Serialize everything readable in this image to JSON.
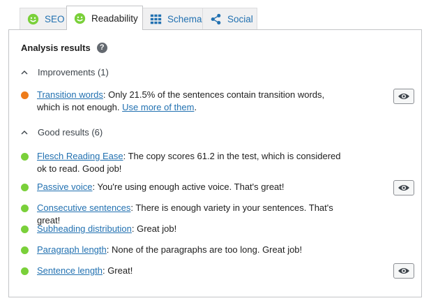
{
  "tabs": [
    {
      "label": "SEO",
      "icon": "smiley-icon"
    },
    {
      "label": "Readability",
      "icon": "smiley-icon"
    },
    {
      "label": "Schema",
      "icon": "grid-icon"
    },
    {
      "label": "Social",
      "icon": "share-icon"
    }
  ],
  "active_tab": "Readability",
  "colors": {
    "good": "#7ad03a",
    "improvement": "#ee7c1b",
    "link": "#2271b1"
  },
  "panel": {
    "title": "Analysis results",
    "help_label": "?",
    "improvements": {
      "heading": "Improvements (1)",
      "items": [
        {
          "link": "Transition words",
          "text": ": Only 21.5% of the sentences contain transition words, which is not enough. ",
          "link2": "Use more of them",
          "text2": "."
        }
      ]
    },
    "good": {
      "heading": "Good results (6)",
      "items": [
        {
          "link": "Flesch Reading Ease",
          "text": ": The copy scores 61.2 in the test, which is considered ok to read. Good job!"
        },
        {
          "link": "Passive voice",
          "text": ": You're using enough active voice. That's great!"
        },
        {
          "link": "Consecutive sentences",
          "text": ": There is enough variety in your sentences. That's great!"
        },
        {
          "link": "Subheading distribution",
          "text": ": Great job!"
        },
        {
          "link": "Paragraph length",
          "text": ": None of the paragraphs are too long. Great job!"
        },
        {
          "link": "Sentence length",
          "text": ": Great!"
        }
      ]
    }
  }
}
